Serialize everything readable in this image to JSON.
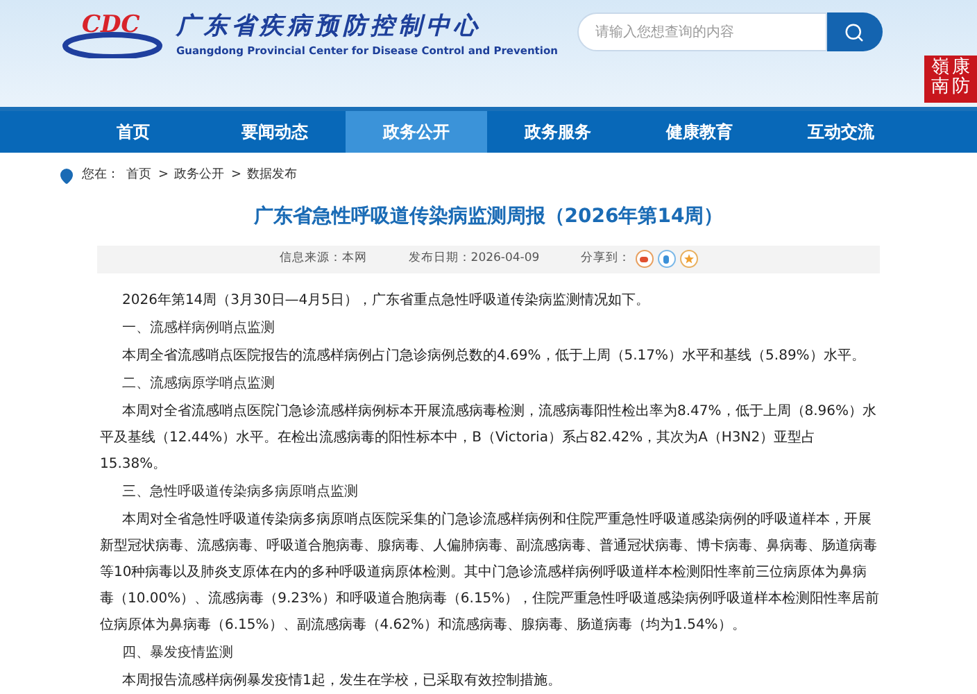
{
  "header": {
    "logo_mark": "CDC",
    "title_cn": "广东省疾病预防控制中心",
    "title_en": "Guangdong Provincial Center for Disease Control and Prevention",
    "search": {
      "placeholder": "请输入您想查询的内容"
    },
    "seal": [
      "嶺南",
      "康防"
    ]
  },
  "nav": [
    {
      "label": "首页",
      "selected": false
    },
    {
      "label": "要闻动态",
      "selected": false
    },
    {
      "label": "政务公开",
      "selected": true
    },
    {
      "label": "政务服务",
      "selected": false
    },
    {
      "label": "健康教育",
      "selected": false
    },
    {
      "label": "互动交流",
      "selected": false
    }
  ],
  "breadcrumb": {
    "prefix": "您在：",
    "items": [
      "首页",
      "政务公开",
      "数据发布"
    ],
    "separator": ">"
  },
  "article": {
    "title": "广东省急性呼吸道传染病监测周报（2026年第14周）",
    "meta": {
      "source": "信息来源：本网",
      "date": "发布日期：2026-04-09",
      "share": "分享到："
    },
    "paragraphs": [
      {
        "kind": "text",
        "text": "2026年第14周（3月30日—4月5日），广东省重点急性呼吸道传染病监测情况如下。"
      },
      {
        "kind": "heading",
        "text": "一、流感样病例哨点监测"
      },
      {
        "kind": "text",
        "text": "本周全省流感哨点医院报告的流感样病例占门急诊病例总数的4.69%，低于上周（5.17%）水平和基线（5.89%）水平。"
      },
      {
        "kind": "heading",
        "text": "二、流感病原学哨点监测"
      },
      {
        "kind": "text",
        "text": "本周对全省流感哨点医院门急诊流感样病例标本开展流感病毒检测，流感病毒阳性检出率为8.47%，低于上周（8.96%）水平及基线（12.44%）水平。在检出流感病毒的阳性标本中，B（Victoria）系占82.42%，其次为A（H3N2）亚型占15.38%。"
      },
      {
        "kind": "heading",
        "text": "三、急性呼吸道传染病多病原哨点监测"
      },
      {
        "kind": "text",
        "text": "本周对全省急性呼吸道传染病多病原哨点医院采集的门急诊流感样病例和住院严重急性呼吸道感染病例的呼吸道样本，开展新型冠状病毒、流感病毒、呼吸道合胞病毒、腺病毒、人偏肺病毒、副流感病毒、普通冠状病毒、博卡病毒、鼻病毒、肠道病毒等10种病毒以及肺炎支原体在内的多种呼吸道病原体检测。其中门急诊流感样病例呼吸道样本检测阳性率前三位病原体为鼻病毒（10.00%）、流感病毒（9.23%）和呼吸道合胞病毒（6.15%），住院严重急性呼吸道感染病例呼吸道样本检测阳性率居前位病原体为鼻病毒（6.15%）、副流感病毒（4.62%）和流感病毒、腺病毒、肠道病毒（均为1.54%）。"
      },
      {
        "kind": "heading",
        "text": "四、暴发疫情监测"
      },
      {
        "kind": "text",
        "text": "本周报告流感样病例暴发疫情1起，发生在学校，已采取有效控制措施。"
      }
    ]
  }
}
